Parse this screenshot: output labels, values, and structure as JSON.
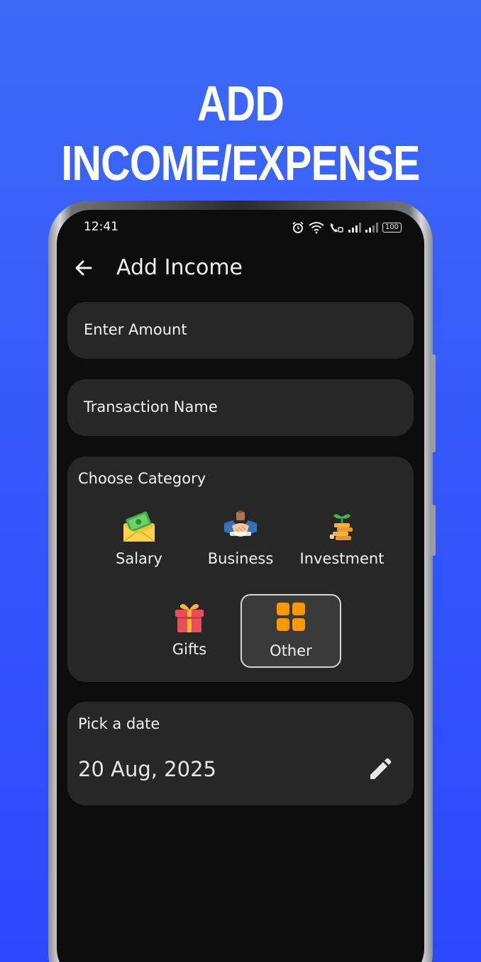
{
  "promo": {
    "headline": "ADD INCOME/EXPENSE"
  },
  "status_bar": {
    "time": "12:41",
    "battery": "100"
  },
  "app_bar": {
    "title": "Add Income",
    "back_icon": "arrow-left-icon"
  },
  "form": {
    "amount": {
      "placeholder": "Enter Amount",
      "value": ""
    },
    "name": {
      "placeholder": "Transaction Name",
      "value": ""
    },
    "category": {
      "label": "Choose Category",
      "selected": "Other",
      "items": [
        {
          "label": "Salary",
          "icon": "money-envelope-icon"
        },
        {
          "label": "Business",
          "icon": "handshake-icon"
        },
        {
          "label": "Investment",
          "icon": "growth-coins-icon"
        },
        {
          "label": "Gifts",
          "icon": "gift-icon"
        },
        {
          "label": "Other",
          "icon": "grid-icon"
        }
      ]
    },
    "date": {
      "label": "Pick a date",
      "value": "20 Aug, 2025",
      "edit_icon": "pencil-icon"
    }
  },
  "colors": {
    "background": "#3557fb",
    "screen": "#0d0d0d",
    "card": "#272727",
    "accent_orange": "#ff9800"
  }
}
